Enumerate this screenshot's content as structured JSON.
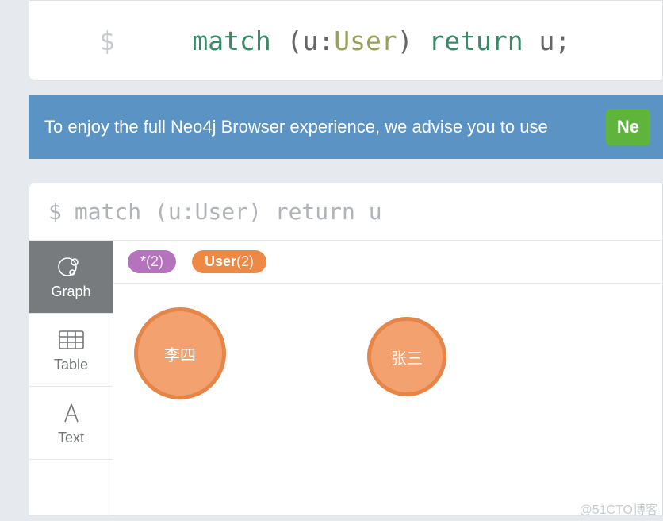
{
  "editor": {
    "prompt": "$",
    "tokens": {
      "kw_match": "match",
      "open_paren": "(",
      "var": "u",
      "colon": ":",
      "type": "User",
      "close_paren": ")",
      "kw_return": "return",
      "var2": "u",
      "semi": ";"
    }
  },
  "notice": {
    "text": "To enjoy the full Neo4j Browser experience, we advise you to use",
    "cta": "Ne"
  },
  "result": {
    "header_prompt": "$",
    "header_query": "match (u:User) return u",
    "views": {
      "graph": "Graph",
      "table": "Table",
      "text": "Text"
    },
    "labels": {
      "all": {
        "symbol": "*",
        "count": "(2)"
      },
      "user": {
        "name": "User",
        "count": "(2)"
      }
    },
    "nodes": [
      {
        "caption": "李四"
      },
      {
        "caption": "张三"
      }
    ]
  },
  "watermark": "@51CTO博客"
}
